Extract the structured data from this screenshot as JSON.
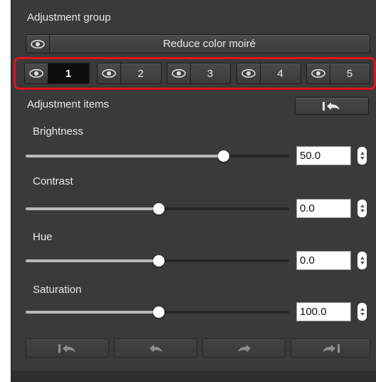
{
  "adjustment_group": {
    "title": "Adjustment group",
    "main_button_label": "Reduce color moiré",
    "groups": [
      {
        "label": "1",
        "active": true
      },
      {
        "label": "2",
        "active": false
      },
      {
        "label": "3",
        "active": false
      },
      {
        "label": "4",
        "active": false
      },
      {
        "label": "5",
        "active": false
      }
    ]
  },
  "adjustment_items": {
    "title": "Adjustment items",
    "reset_icon": "reset-to-default-icon",
    "sliders": [
      {
        "label": "Brightness",
        "value": "50.0"
      },
      {
        "label": "Contrast",
        "value": "0.0"
      },
      {
        "label": "Hue",
        "value": "0.0"
      },
      {
        "label": "Saturation",
        "value": "100.0"
      }
    ]
  },
  "bottom_bar": {
    "icons": [
      "revert-to-original-icon",
      "undo-icon",
      "redo-icon",
      "go-to-latest-icon"
    ]
  },
  "colors": {
    "panel": "#3a3a3a",
    "highlight": "#e0141e",
    "active_tab": "#0d0d0d"
  }
}
